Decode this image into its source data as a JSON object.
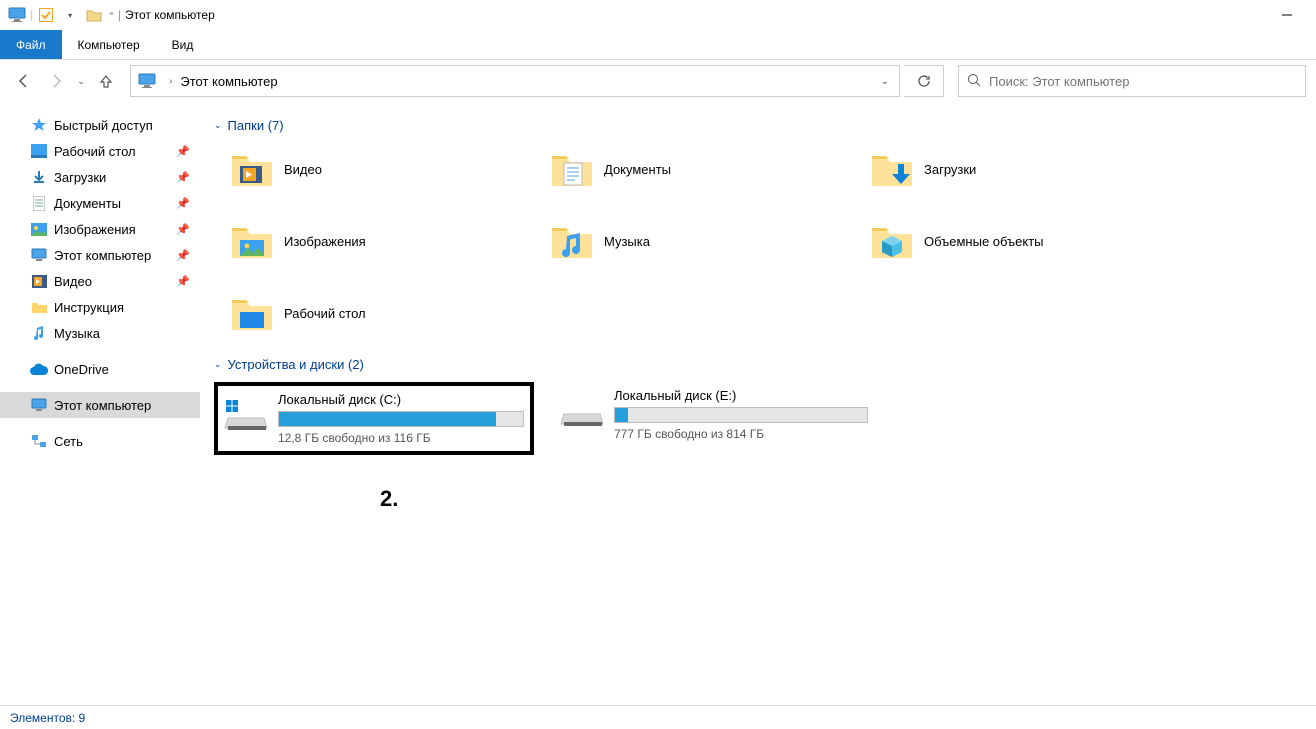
{
  "titlebar": {
    "title": "Этот компьютер"
  },
  "ribbon": {
    "file": "Файл",
    "computer": "Компьютер",
    "view": "Вид"
  },
  "nav": {
    "crumb": "Этот компьютер",
    "search_placeholder": "Поиск: Этот компьютер"
  },
  "sidebar": {
    "quick_access": "Быстрый доступ",
    "desktop": "Рабочий стол",
    "downloads": "Загрузки",
    "documents": "Документы",
    "pictures": "Изображения",
    "this_pc_q": "Этот компьютер",
    "video": "Видео",
    "instrukcia": "Инструкция",
    "music": "Музыка",
    "onedrive": "OneDrive",
    "this_pc": "Этот компьютер",
    "network": "Сеть"
  },
  "sections": {
    "folders": "Папки (7)",
    "devices": "Устройства и диски (2)"
  },
  "folders": {
    "video": "Видео",
    "documents": "Документы",
    "downloads": "Загрузки",
    "pictures": "Изображения",
    "music": "Музыка",
    "objects3d": "Объемные объекты",
    "desktop": "Рабочий стол"
  },
  "drives": {
    "c": {
      "name": "Локальный диск (C:)",
      "free": "12,8 ГБ свободно из 116 ГБ",
      "fill_pct": 89
    },
    "e": {
      "name": "Локальный диск (E:)",
      "free": "777 ГБ свободно из 814 ГБ",
      "fill_pct": 5
    }
  },
  "annotation": "2.",
  "statusbar": {
    "items": "Элементов: 9"
  }
}
